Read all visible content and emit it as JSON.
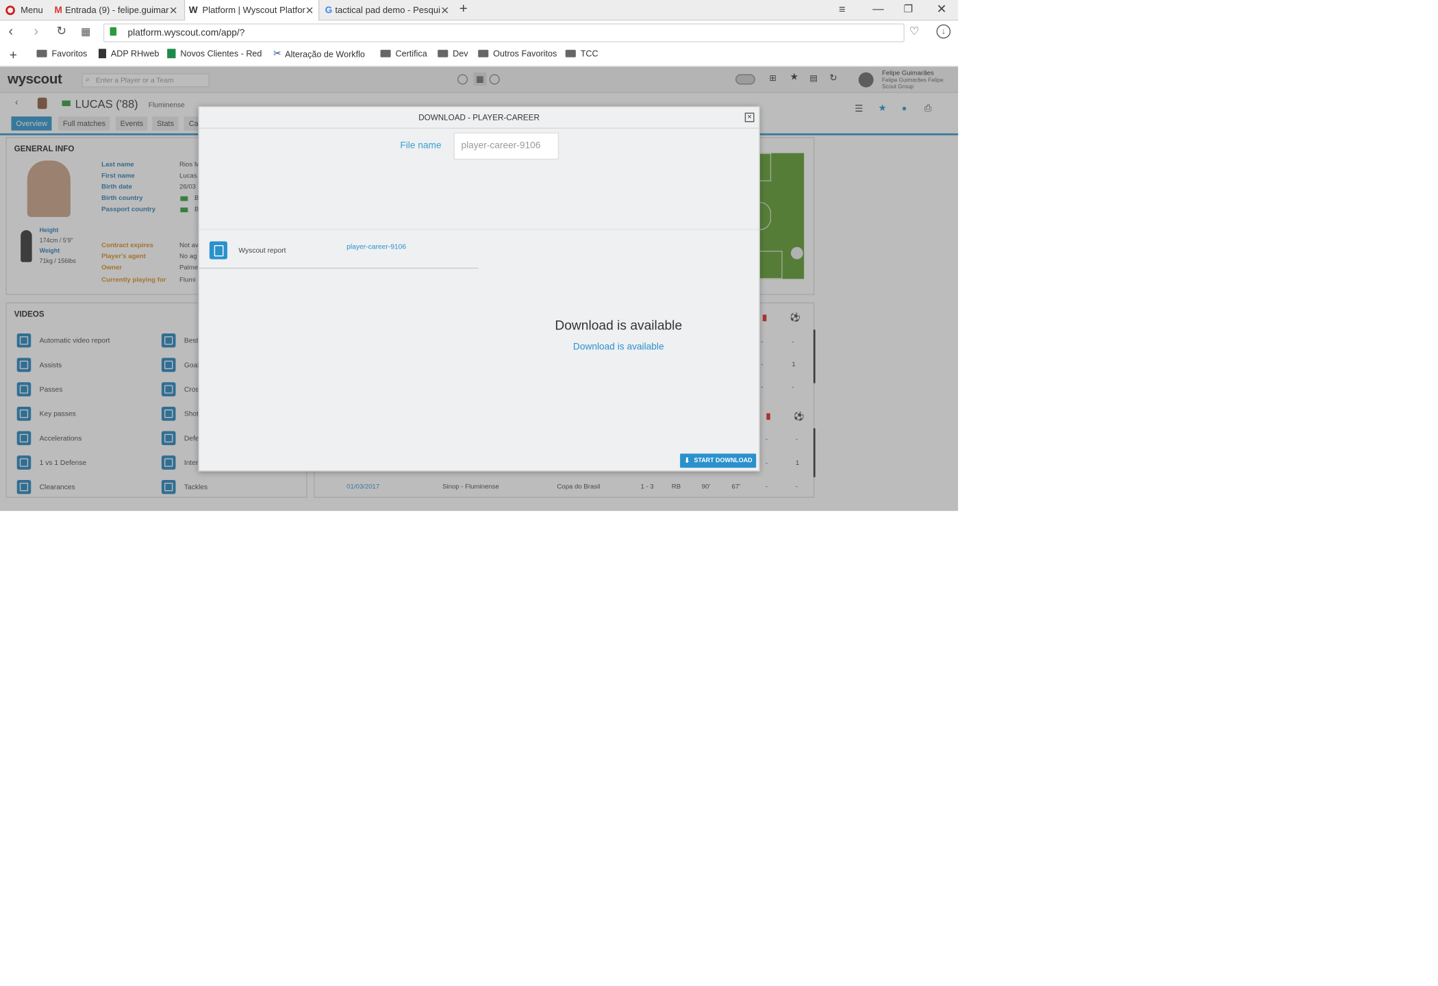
{
  "browser": {
    "menu_label": "Menu",
    "tabs": [
      {
        "title": "Entrada (9) - felipe.guimar"
      },
      {
        "title": "Platform | Wyscout Platfor"
      },
      {
        "title": "tactical pad demo - Pesqui"
      }
    ],
    "url": "platform.wyscout.com/app/?",
    "bookmarks": [
      "Favoritos",
      "ADP RHweb",
      "Novos Clientes - Red",
      "Alteração de Workflo",
      "Certifica",
      "Dev",
      "Outros Favoritos",
      "TCC"
    ]
  },
  "app": {
    "logo": "wyscout",
    "search_placeholder": "Enter a Player or a Team",
    "user_name": "Felipe Guimarães",
    "user_sub1": "Felipe Guimarães Felipe",
    "user_sub2": "Scout Group",
    "player_name": "LUCAS ('88)",
    "player_team": "Fluminense",
    "tabs": [
      "Overview",
      "Full matches",
      "Events",
      "Stats",
      "Ca"
    ],
    "general_info": {
      "title": "GENERAL INFO",
      "labels": [
        "Last name",
        "First name",
        "Birth date",
        "Birth country",
        "Passport country"
      ],
      "values": [
        "Rios M",
        "Lucas",
        "26/03",
        "B",
        "B"
      ],
      "height_label": "Height",
      "height_value": "174cm / 5'9\"",
      "weight_label": "Weight",
      "weight_value": "71kg / 156lbs",
      "contract_labels": [
        "Contract expires",
        "Player's agent",
        "Owner",
        "Currently playing for"
      ],
      "contract_values": [
        "Not av",
        "No ag",
        "Palme",
        "Flumi"
      ]
    },
    "videos": {
      "title": "VIDEOS",
      "col1": [
        "Automatic video report",
        "Assists",
        "Passes",
        "Key passes",
        "Accelerations",
        "1 vs 1 Defense",
        "Clearances"
      ],
      "col2": [
        "Best",
        "Goal",
        "Cros",
        "Shot",
        "Defe",
        "Inter",
        "Tackles"
      ]
    },
    "table": {
      "row_a": [
        "-",
        "-"
      ],
      "row_b": [
        "-",
        "1"
      ],
      "row_c": [
        "-",
        "-"
      ],
      "row_d": [
        "-",
        "-"
      ],
      "row_e": [
        "-",
        "1"
      ],
      "last_row": {
        "date": "01/03/2017",
        "match": "Sinop - Fluminense",
        "competition": "Copa do Brasil",
        "score": "1 - 3",
        "position": "RB",
        "minutes": "90'",
        "minute2": "67'",
        "c1": "-",
        "c2": "-"
      }
    }
  },
  "modal": {
    "title": "DOWNLOAD - PLAYER-CAREER",
    "close": "×",
    "file_name_label": "File name",
    "file_name_placeholder": "player-career-9106",
    "report_label": "Wyscout report",
    "report_link": "player-career-9106",
    "available_title": "Download is available",
    "available_link": "Download is available",
    "start_button": "START DOWNLOAD"
  }
}
